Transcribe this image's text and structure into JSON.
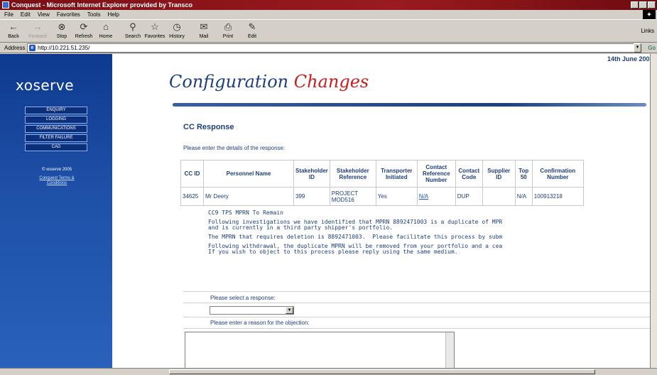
{
  "window": {
    "title": "Conquest - Microsoft Internet Explorer provided by Transco"
  },
  "menu": [
    "File",
    "Edit",
    "View",
    "Favorites",
    "Tools",
    "Help"
  ],
  "toolbar": {
    "back": "Back",
    "forward": "Forward",
    "stop": "Stop",
    "refresh": "Refresh",
    "home": "Home",
    "search": "Search",
    "favorites": "Favorites",
    "history": "History",
    "mail": "Mail",
    "print": "Print",
    "edit": "Edit",
    "links": "Links"
  },
  "address": {
    "label": "Address",
    "url": "http://10.221.51.235/",
    "go": "Go"
  },
  "sidebar": {
    "logo": "xoserve",
    "nav": [
      "ENQUIRY",
      "LOGGING",
      "COMMUNICATIONS",
      "FILTER FAILURE",
      "CAD"
    ],
    "copyright": "© xoserve 2005",
    "terms": "Conquest Terms & Conditions"
  },
  "header": {
    "title_part1": "Configuration",
    "title_part2": "Changes",
    "date": "14th June 2005"
  },
  "section": {
    "heading": "CC Response",
    "instruction": "Please enter the details of the response:"
  },
  "table": {
    "headers": [
      "CC ID",
      "Personnel Name",
      "Stakeholder ID",
      "Stakeholder Reference",
      "Transporter Initiated",
      "Contact Reference Number",
      "Contact Code",
      "Supplier ID",
      "Top 50",
      "Confirmation Number"
    ],
    "row": [
      "34625",
      "Mr Deery",
      "399",
      "PROJECT MOD516",
      "Yes",
      "N/A",
      "DUP",
      "",
      "N/A",
      "100913218"
    ]
  },
  "message": {
    "subject": "CC9 TPS MPRN To Remain",
    "p1_l1": "Following investigations we have identified that MPRN 8892471003 is a duplicate of MPR",
    "p1_l2": "and is currently in a third party shipper's portfolio.",
    "p2": "The MPRN that requires deletion is 8892471003.  Please facilitate this process by subm",
    "p3_l1": "Following withdrawal, the duplicate MPRN will be removed from your portfolio and a cea",
    "p3_l2": "If you wish to object to this process please reply using the same medium."
  },
  "form": {
    "select_label": "Please select a response:",
    "select_value": "",
    "reason_label": "Please enter a reason for the objection:",
    "reason_value": ""
  }
}
